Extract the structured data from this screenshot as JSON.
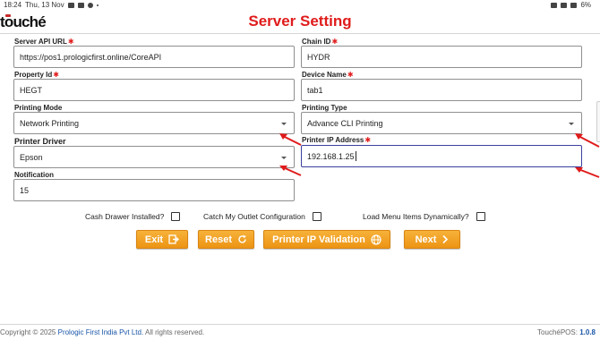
{
  "status_bar": {
    "time": "18:24",
    "date": "Thu, 13 Nov",
    "battery": "6%",
    "icons": [
      "mail-icon",
      "battery-saver-icon",
      "sync-icon",
      "mute-icon",
      "wifi-icon",
      "battery-icon"
    ]
  },
  "header": {
    "logo_text": "touché",
    "title": "Server Setting"
  },
  "fields": {
    "server_api_url": {
      "label": "Server API URL",
      "value": "https://pos1.prologicfirst.online/CoreAPI",
      "required": true
    },
    "chain_id": {
      "label": "Chain ID",
      "value": "HYDR",
      "required": true
    },
    "property_id": {
      "label": "Property Id",
      "value": "HEGT",
      "required": true
    },
    "device_name": {
      "label": "Device Name",
      "value": "tab1",
      "required": true
    },
    "printing_mode": {
      "label": "Printing Mode",
      "value": "Network Printing"
    },
    "printing_type": {
      "label": "Printing Type",
      "value": "Advance CLI Printing"
    },
    "printer_driver": {
      "label": "Printer Driver",
      "value": "Epson"
    },
    "printer_ip_address": {
      "label": "Printer IP Address",
      "value": "192.168.1.25",
      "required": true
    },
    "notification": {
      "label": "Notification",
      "value": "15"
    }
  },
  "checkboxes": {
    "cash_drawer": {
      "label": "Cash Drawer Installed?",
      "checked": false
    },
    "catch_outlet": {
      "label": "Catch My Outlet Configuration",
      "checked": false
    },
    "load_menu": {
      "label": "Load Menu Items Dynamically?",
      "checked": false
    }
  },
  "buttons": {
    "exit": "Exit",
    "reset": "Reset",
    "printer_ip_validation": "Printer IP Validation",
    "next": "Next"
  },
  "footer": {
    "copyright_prefix": "Copyright © 2025",
    "company": "Prologic First India Pvt Ltd.",
    "rights": "All rights reserved.",
    "product": "TouchéPOS:",
    "version": "1.0.8"
  },
  "colors": {
    "title_red": "#e01b1b",
    "button_orange": "#ec9414",
    "focus_border": "#3b3f9e",
    "annotation_red": "#e01b1b",
    "link_blue": "#1a56a8"
  }
}
